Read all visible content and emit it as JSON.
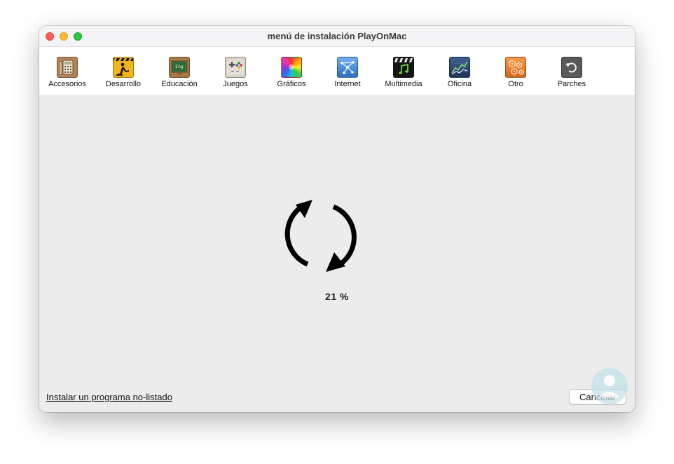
{
  "window": {
    "title": "menú de instalación PlayOnMac"
  },
  "toolbar": {
    "items": [
      {
        "label": "Accesorios",
        "icon": "calculator-icon",
        "color": "#b5835a"
      },
      {
        "label": "Desarrollo",
        "icon": "construction-icon",
        "color": "#f2b51c"
      },
      {
        "label": "Educación",
        "icon": "chalkboard-icon",
        "color": "#2f6a3a"
      },
      {
        "label": "Juegos",
        "icon": "gamepad-icon",
        "color": "#d9d4c8"
      },
      {
        "label": "Gráficos",
        "icon": "color-wheel-icon",
        "color": "#e34b8c"
      },
      {
        "label": "Internet",
        "icon": "network-icon",
        "color": "#4a90d9"
      },
      {
        "label": "Multimedia",
        "icon": "clapperboard-icon",
        "color": "#1a1a1a"
      },
      {
        "label": "Oficina",
        "icon": "chart-icon",
        "color": "#2d4a7a"
      },
      {
        "label": "Otro",
        "icon": "gears-icon",
        "color": "#e87b2a"
      },
      {
        "label": "Parches",
        "icon": "undo-icon",
        "color": "#5a5a5a"
      }
    ]
  },
  "progress": {
    "percent_text": "21 %",
    "value": 21
  },
  "footer": {
    "install_link": "Instalar un programa no-listado",
    "cancel_label": "Cancelar"
  }
}
